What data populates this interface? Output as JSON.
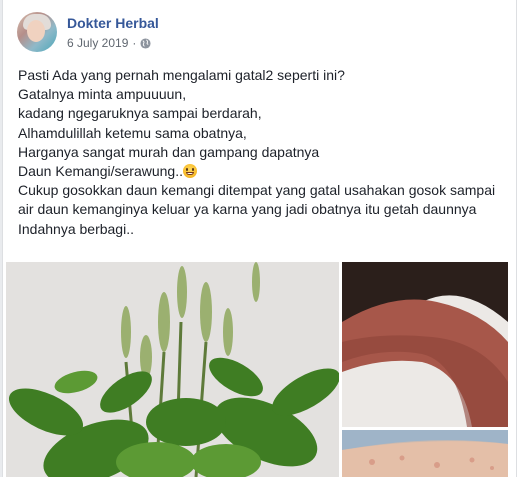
{
  "post": {
    "author": "Dokter Herbal",
    "date": "6 July 2019",
    "separator": "·",
    "audience_icon": "globe-icon",
    "lines": [
      "Pasti Ada yang pernah mengalami gatal2 seperti ini?",
      "Gatalnya minta ampuuuun,",
      "kadang ngegaruknya sampai berdarah,",
      "Alhamdulillah ketemu sama obatnya,",
      "Harganya sangat murah dan gampang dapatnya",
      "Daun Kemangi/serawung..",
      "Cukup gosokkan daun kemangi ditempat yang gatal usahakan gosok sampai air daun kemanginya keluar ya karna yang jadi obatnya itu getah daunnya",
      "Indahnya berbagi.."
    ],
    "emoji": "grinning-face-emoji"
  },
  "colors": {
    "author_link": "#365899",
    "meta_text": "#606770",
    "body_text": "#1d2129",
    "page_bg": "#e9ebee"
  }
}
